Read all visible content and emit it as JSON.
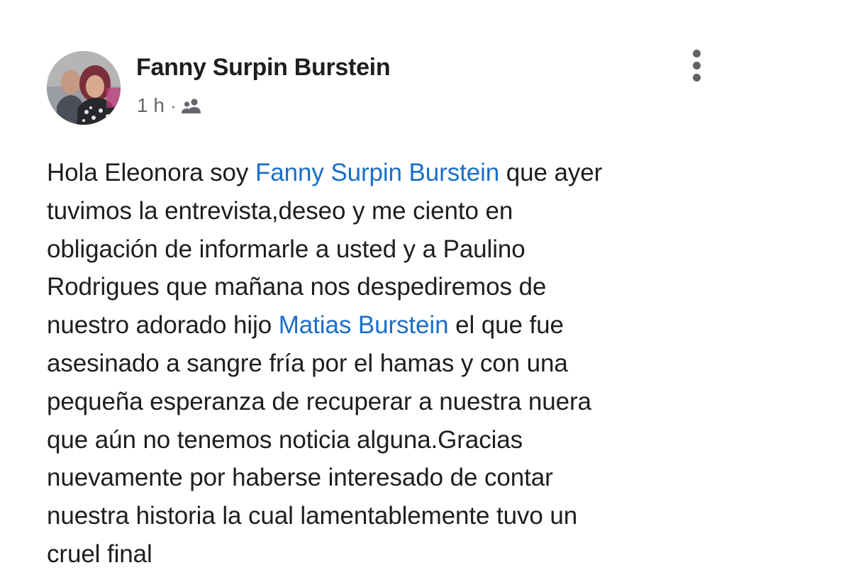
{
  "post": {
    "author": {
      "name": "Fanny Surpin Burstein",
      "avatar_icon": "profile-photo-avatar"
    },
    "meta": {
      "time": "1 h",
      "separator": "·",
      "audience_icon": "friends-icon"
    },
    "menu_icon": "more-options-icon",
    "body_lines": [
      [
        {
          "text": "Hola Eleonora soy "
        },
        {
          "text": "Fanny Surpin Burstein",
          "mention": true
        },
        {
          "text": " que ayer"
        }
      ],
      [
        {
          "text": "tuvimos la entrevista,deseo y me ciento en"
        }
      ],
      [
        {
          "text": "obligación de informarle a usted y a Paulino"
        }
      ],
      [
        {
          "text": "Rodrigues que mañana nos despediremos de"
        }
      ],
      [
        {
          "text": "nuestro adorado hijo "
        },
        {
          "text": "Matias Burstein",
          "mention": true
        },
        {
          "text": " el que fue"
        }
      ],
      [
        {
          "text": "asesinado a sangre fría por el hamas y con una"
        }
      ],
      [
        {
          "text": "pequeña esperanza de recuperar a nuestra nuera"
        }
      ],
      [
        {
          "text": "que aún no tenemos noticia alguna.Gracias"
        }
      ],
      [
        {
          "text": "nuevamente por haberse interesado de contar"
        }
      ],
      [
        {
          "text": "nuestra historia la cual lamentablemente tuvo un"
        }
      ],
      [
        {
          "text": "cruel final"
        }
      ]
    ]
  },
  "colors": {
    "text": "#1c1e21",
    "secondary_text": "#65676b",
    "mention": "#1a6ec9",
    "background": "#ffffff"
  }
}
